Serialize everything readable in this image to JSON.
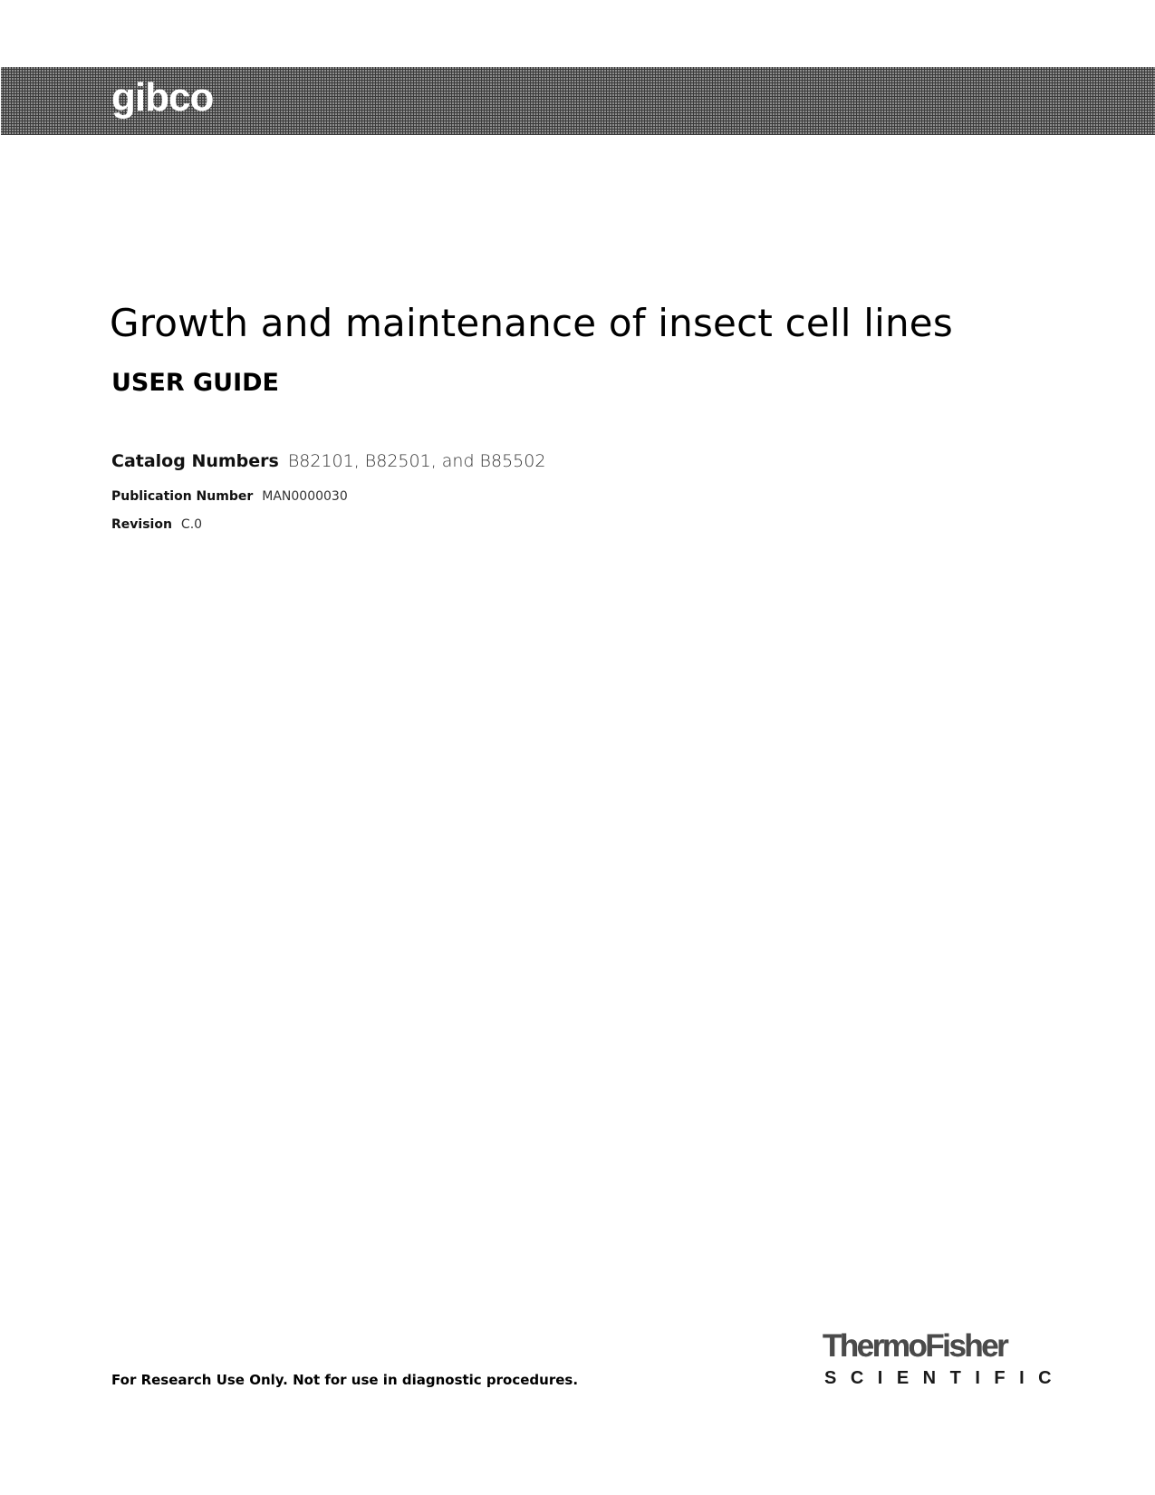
{
  "header": {
    "brand": "gibco",
    "banner_color": "#3a3a3a"
  },
  "document": {
    "title": "Growth and maintenance of insect cell lines",
    "subtitle": "USER GUIDE",
    "catalog": {
      "label": "Catalog Numbers",
      "value": "B82101, B82501, and B85502"
    },
    "publication": {
      "label": "Publication Number",
      "value": "MAN0000030"
    },
    "revision": {
      "label": "Revision",
      "value": "C.0"
    }
  },
  "footer": {
    "disclaimer": "For Research Use Only. Not for use in diagnostic procedures.",
    "company_logo": {
      "main": "ThermoFisher",
      "sub": "SCIENTIFIC"
    }
  }
}
